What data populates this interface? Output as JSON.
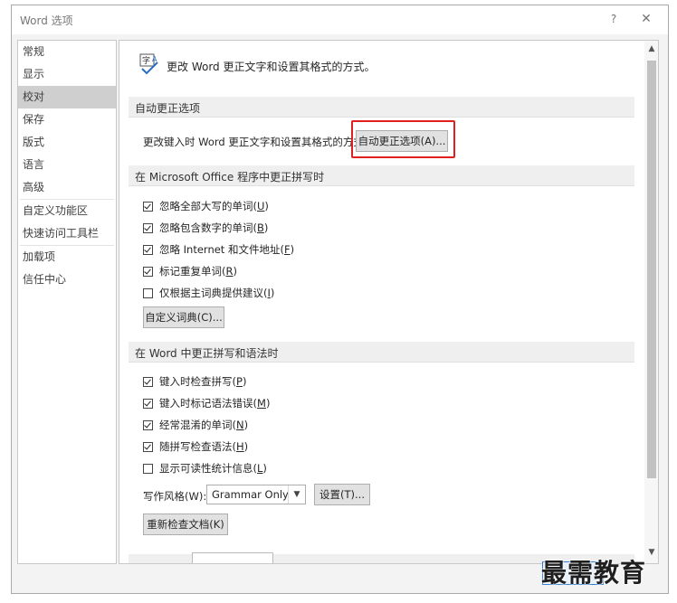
{
  "window": {
    "title": "Word 选项",
    "help": "?",
    "close": "✕"
  },
  "sidebar": {
    "items": [
      {
        "label": "常规",
        "active": false
      },
      {
        "label": "显示",
        "active": false
      },
      {
        "label": "校对",
        "active": true
      },
      {
        "label": "保存",
        "active": false
      },
      {
        "label": "版式",
        "active": false
      },
      {
        "label": "语言",
        "active": false
      },
      {
        "label": "高级",
        "active": false
      },
      {
        "label": "自定义功能区",
        "active": false
      },
      {
        "label": "快速访问工具栏",
        "active": false
      },
      {
        "label": "加载项",
        "active": false
      },
      {
        "label": "信任中心",
        "active": false
      }
    ]
  },
  "header": {
    "text": "更改 Word 更正文字和设置其格式的方式。"
  },
  "autocorrect": {
    "section_title": "自动更正选项",
    "description": "更改键入时 Word 更正文字和设置其格式的方式:",
    "button_label": "自动更正选项(A)..."
  },
  "office_spelling": {
    "section_title": "在 Microsoft Office 程序中更正拼写时",
    "options": [
      {
        "label": "忽略全部大写的单词(",
        "key": "U",
        "suffix": ")",
        "checked": true
      },
      {
        "label": "忽略包含数字的单词(",
        "key": "B",
        "suffix": ")",
        "checked": true
      },
      {
        "label": "忽略 Internet 和文件地址(",
        "key": "F",
        "suffix": ")",
        "checked": true
      },
      {
        "label": "标记重复单词(",
        "key": "R",
        "suffix": ")",
        "checked": true
      },
      {
        "label": "仅根据主词典提供建议(",
        "key": "I",
        "suffix": ")",
        "checked": false
      }
    ],
    "dictionary_button": "自定义词典(C)..."
  },
  "word_spelling": {
    "section_title": "在 Word 中更正拼写和语法时",
    "options": [
      {
        "label": "键入时检查拼写(",
        "key": "P",
        "suffix": ")",
        "checked": true
      },
      {
        "label": "键入时标记语法错误(",
        "key": "M",
        "suffix": ")",
        "checked": true
      },
      {
        "label": "经常混淆的单词(",
        "key": "N",
        "suffix": ")",
        "checked": true
      },
      {
        "label": "随拼写检查语法(",
        "key": "H",
        "suffix": ")",
        "checked": true
      },
      {
        "label": "显示可读性统计信息(",
        "key": "L",
        "suffix": ")",
        "checked": false
      }
    ],
    "writing_style_label": "写作风格(W):",
    "writing_style_value": "Grammar Only",
    "settings_button": "设置(T)...",
    "recheck_button": "重新检查文档(K)"
  },
  "watermark": "最需教育"
}
